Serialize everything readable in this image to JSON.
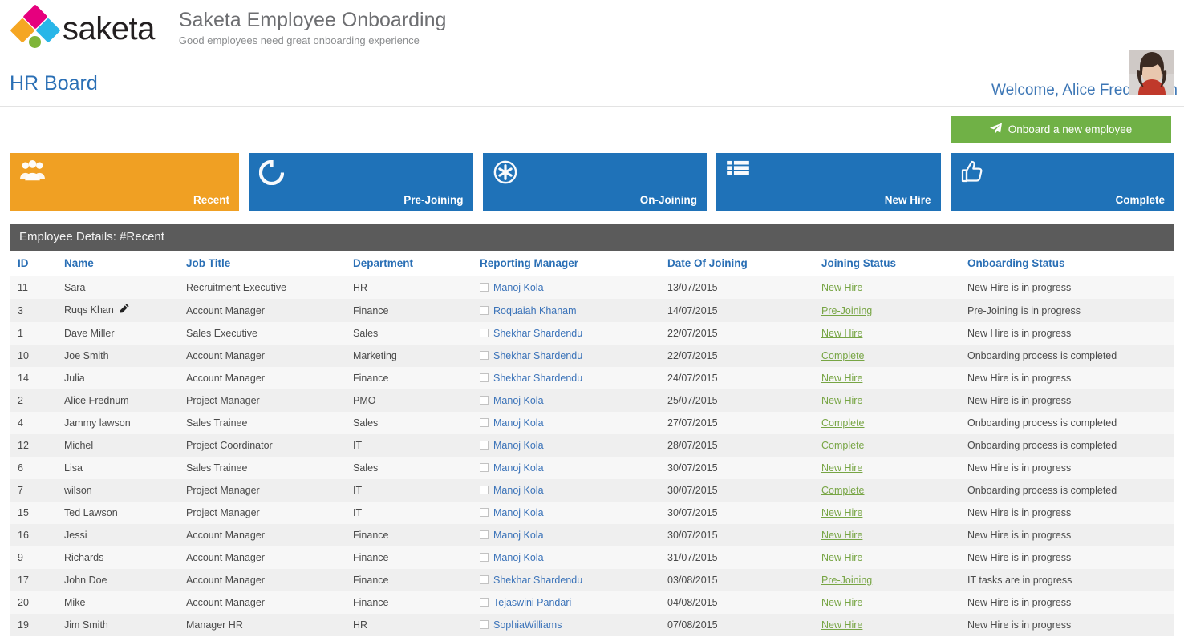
{
  "brand": {
    "logo_word": "saketa",
    "logo_icon": "saketa-diamond-logo",
    "app_title": "Saketa Employee Onboarding",
    "app_subtitle": "Good employees need great onboarding experience",
    "colors": {
      "logo_pink": "#e6007e",
      "logo_orange": "#f5a623",
      "logo_cyan": "#29b6e8",
      "logo_green": "#7fb539"
    }
  },
  "header": {
    "page_title": "HR Board",
    "welcome_text": "Welcome, Alice Fredenhum",
    "avatar_icon": "user-avatar-photo"
  },
  "actions": {
    "onboard_label": "Onboard a new employee",
    "onboard_icon": "paper-plane-icon",
    "onboard_color": "#70b146"
  },
  "tiles": [
    {
      "label": "Recent",
      "icon": "users-group-icon",
      "color": "#f0a023",
      "active": true
    },
    {
      "label": "Pre-Joining",
      "icon": "spinner-circle-icon",
      "color": "#1f72b8",
      "active": false
    },
    {
      "label": "On-Joining",
      "icon": "gear-badge-icon",
      "color": "#1f72b8",
      "active": false
    },
    {
      "label": "New Hire",
      "icon": "list-icon",
      "color": "#1f72b8",
      "active": false
    },
    {
      "label": "Complete",
      "icon": "thumbs-up-icon",
      "color": "#1f72b8",
      "active": false
    }
  ],
  "table": {
    "caption": "Employee Details: #Recent",
    "columns": [
      "ID",
      "Name",
      "Job Title",
      "Department",
      "Reporting Manager",
      "Date Of Joining",
      "Joining Status",
      "Onboarding Status"
    ],
    "rows": [
      {
        "id": "11",
        "name": "Sara",
        "edit": false,
        "job": "Recruitment Executive",
        "dept": "HR",
        "manager": "Manoj Kola",
        "date": "13/07/2015",
        "joining_status": "New Hire",
        "onboarding_status": "New Hire is in progress"
      },
      {
        "id": "3",
        "name": "Ruqs Khan",
        "edit": true,
        "job": "Account Manager",
        "dept": "Finance",
        "manager": "Roquaiah Khanam",
        "date": "14/07/2015",
        "joining_status": "Pre-Joining",
        "onboarding_status": "Pre-Joining is in progress"
      },
      {
        "id": "1",
        "name": "Dave Miller",
        "edit": false,
        "job": "Sales Executive",
        "dept": "Sales",
        "manager": "Shekhar Shardendu",
        "date": "22/07/2015",
        "joining_status": "New Hire",
        "onboarding_status": "New Hire is in progress"
      },
      {
        "id": "10",
        "name": "Joe Smith",
        "edit": false,
        "job": "Account Manager",
        "dept": "Marketing",
        "manager": "Shekhar Shardendu",
        "date": "22/07/2015",
        "joining_status": "Complete",
        "onboarding_status": "Onboarding process is completed"
      },
      {
        "id": "14",
        "name": "Julia",
        "edit": false,
        "job": "Account Manager",
        "dept": "Finance",
        "manager": "Shekhar Shardendu",
        "date": "24/07/2015",
        "joining_status": "New Hire",
        "onboarding_status": "New Hire is in progress"
      },
      {
        "id": "2",
        "name": "Alice Frednum",
        "edit": false,
        "job": "Project Manager",
        "dept": "PMO",
        "manager": "Manoj Kola",
        "date": "25/07/2015",
        "joining_status": "New Hire",
        "onboarding_status": "New Hire is in progress"
      },
      {
        "id": "4",
        "name": "Jammy lawson",
        "edit": false,
        "job": "Sales Trainee",
        "dept": "Sales",
        "manager": "Manoj Kola",
        "date": "27/07/2015",
        "joining_status": "Complete",
        "onboarding_status": "Onboarding process is completed"
      },
      {
        "id": "12",
        "name": "Michel",
        "edit": false,
        "job": "Project Coordinator",
        "dept": "IT",
        "manager": "Manoj Kola",
        "date": "28/07/2015",
        "joining_status": "Complete",
        "onboarding_status": "Onboarding process is completed"
      },
      {
        "id": "6",
        "name": "Lisa",
        "edit": false,
        "job": "Sales Trainee",
        "dept": "Sales",
        "manager": "Manoj Kola",
        "date": "30/07/2015",
        "joining_status": "New Hire",
        "onboarding_status": "New Hire is in progress"
      },
      {
        "id": "7",
        "name": "wilson",
        "edit": false,
        "job": "Project Manager",
        "dept": "IT",
        "manager": "Manoj Kola",
        "date": "30/07/2015",
        "joining_status": "Complete",
        "onboarding_status": "Onboarding process is completed"
      },
      {
        "id": "15",
        "name": "Ted Lawson",
        "edit": false,
        "job": "Project Manager",
        "dept": "IT",
        "manager": "Manoj Kola",
        "date": "30/07/2015",
        "joining_status": "New Hire",
        "onboarding_status": "New Hire is in progress"
      },
      {
        "id": "16",
        "name": "Jessi",
        "edit": false,
        "job": "Account Manager",
        "dept": "Finance",
        "manager": "Manoj Kola",
        "date": "30/07/2015",
        "joining_status": "New Hire",
        "onboarding_status": "New Hire is in progress"
      },
      {
        "id": "9",
        "name": "Richards",
        "edit": false,
        "job": "Account Manager",
        "dept": "Finance",
        "manager": "Manoj Kola",
        "date": "31/07/2015",
        "joining_status": "New Hire",
        "onboarding_status": "New Hire is in progress"
      },
      {
        "id": "17",
        "name": "John Doe",
        "edit": false,
        "job": "Account Manager",
        "dept": "Finance",
        "manager": "Shekhar Shardendu",
        "date": "03/08/2015",
        "joining_status": "Pre-Joining",
        "onboarding_status": "IT tasks are in progress"
      },
      {
        "id": "20",
        "name": "Mike",
        "edit": false,
        "job": "Account Manager",
        "dept": "Finance",
        "manager": "Tejaswini Pandari",
        "date": "04/08/2015",
        "joining_status": "New Hire",
        "onboarding_status": "New Hire is in progress"
      },
      {
        "id": "19",
        "name": "Jim Smith",
        "edit": false,
        "job": "Manager HR",
        "dept": "HR",
        "manager": "SophiaWilliams",
        "date": "07/08/2015",
        "joining_status": "New Hire",
        "onboarding_status": "New Hire is in progress"
      }
    ]
  },
  "theme": {
    "accent_blue": "#2a6fb5",
    "link_green": "#77a544",
    "caption_bg": "#5b5b5b"
  }
}
